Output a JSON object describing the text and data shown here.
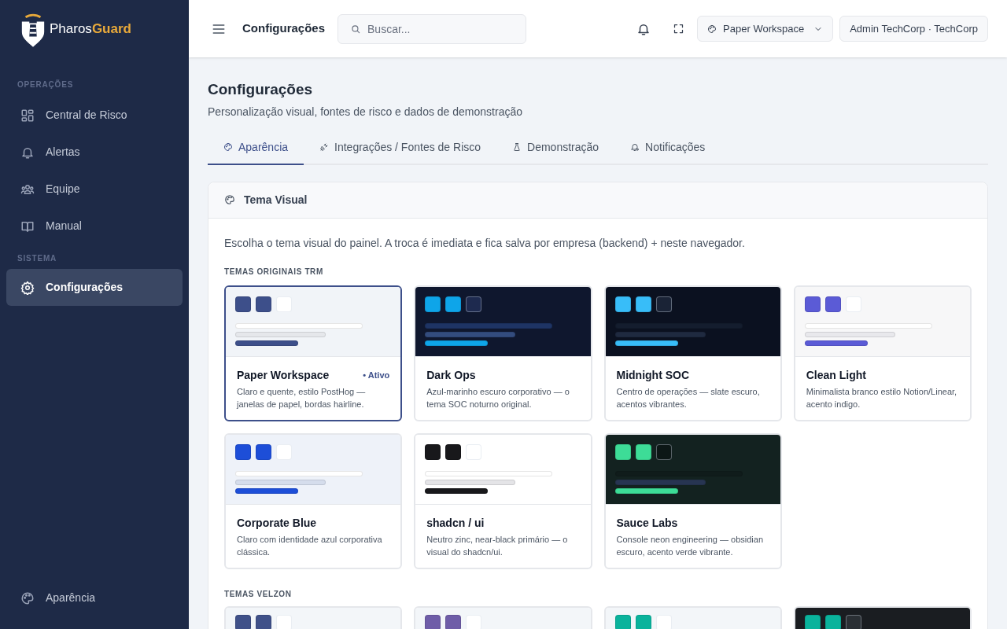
{
  "sidebar": {
    "brand": {
      "first": "Pharos",
      "second": "Guard"
    },
    "sections": [
      {
        "title": "OPERAÇÕES",
        "items": [
          {
            "label": "Central de Risco",
            "selected": false
          },
          {
            "label": "Alertas",
            "selected": false
          },
          {
            "label": "Equipe",
            "selected": false
          },
          {
            "label": "Manual",
            "selected": false
          }
        ]
      },
      {
        "title": "SISTEMA",
        "items": [
          {
            "label": "Configurações",
            "selected": true
          }
        ]
      }
    ],
    "footer": {
      "label": "Aparência"
    }
  },
  "header": {
    "title": "Configurações",
    "search": {
      "placeholder": "Buscar..."
    },
    "theme_button": "Paper Workspace",
    "account_button": "Admin TechCorp · TechCorp"
  },
  "page": {
    "title": "Configurações",
    "subtitle": "Personalização visual, fontes de risco e dados de demonstração"
  },
  "tabs": [
    {
      "label": "Aparência",
      "selected": true
    },
    {
      "label": "Integrações / Fontes de Risco",
      "selected": false
    },
    {
      "label": "Demonstração",
      "selected": false
    },
    {
      "label": "Notificações",
      "selected": false
    }
  ],
  "panel": {
    "title": "Tema Visual",
    "description": "Escolha o tema visual do painel. A troca é imediata e fica salva por empresa (backend) + neste navegador.",
    "groups": [
      {
        "title": "TEMAS ORIGINAIS TRM",
        "themes": [
          {
            "name": "Paper Workspace",
            "description": "Claro e quente, estilo PostHog — janelas de papel, bordas hairline.",
            "selected": true,
            "active_label": "• Ativo",
            "color": "#3d4f8a"
          },
          {
            "name": "Dark Ops",
            "description": "Azul-marinho escuro corporativo — o tema SOC noturno original.",
            "selected": false,
            "color": "#0ea5e9"
          },
          {
            "name": "Midnight SOC",
            "description": "Centro de operações — slate escuro, acentos vibrantes.",
            "selected": false,
            "color": "#38bdf8"
          },
          {
            "name": "Clean Light",
            "description": "Minimalista branco estilo Notion/Linear, acento indigo.",
            "selected": false,
            "color": "#5b5bd6"
          },
          {
            "name": "Corporate Blue",
            "description": "Claro com identidade azul corporativa clássica.",
            "selected": false,
            "color": "#1d4ed8"
          },
          {
            "name": "shadcn / ui",
            "description": "Neutro zinc, near-black primário — o visual do shadcn/ui.",
            "selected": false,
            "color": "#18181b"
          },
          {
            "name": "Sauce Labs",
            "description": "Console neon engineering — obsidian escuro, acento verde vibrante.",
            "selected": false,
            "color": "#3ddc97"
          }
        ]
      },
      {
        "title": "TEMAS VELZON",
        "themes": [
          {
            "color": "#405189"
          },
          {
            "color": "#6f5da8"
          },
          {
            "color": "#0ab39c"
          },
          {
            "color": "#0ab39c"
          }
        ]
      }
    ]
  }
}
